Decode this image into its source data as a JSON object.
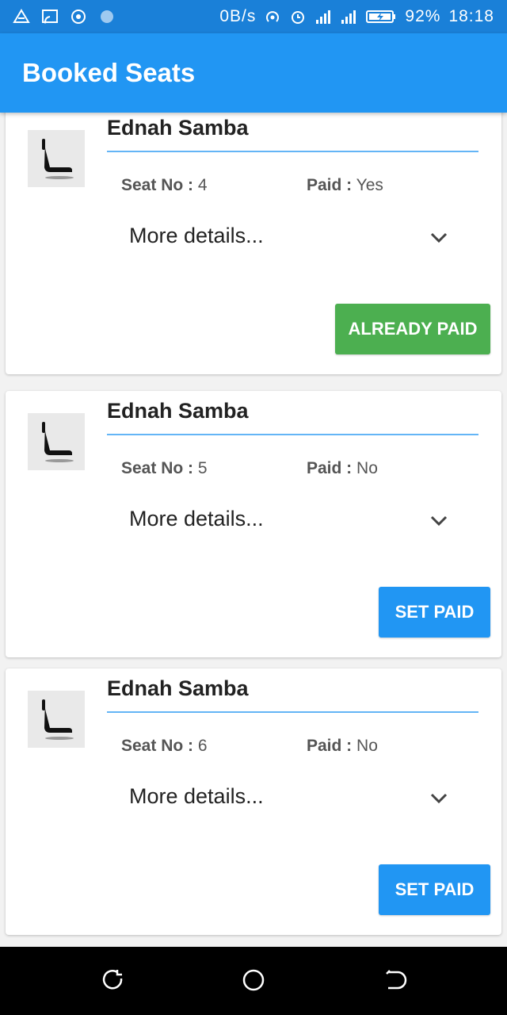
{
  "status_bar": {
    "left_icons": [
      "drive-icon",
      "cast-icon",
      "target-icon",
      "circle-dot-icon"
    ],
    "network_speed": "0B/s",
    "battery": "92%",
    "time": "18:18"
  },
  "app_bar": {
    "title": "Booked Seats"
  },
  "labels": {
    "seat_no": "Seat No :",
    "paid": "Paid :",
    "more_details": "More details..."
  },
  "bookings": [
    {
      "name": "Ednah Samba",
      "seat_no": "4",
      "paid": "Yes",
      "button_label": "ALREADY PAID",
      "button_color": "#4caf50"
    },
    {
      "name": "Ednah Samba",
      "seat_no": "5",
      "paid": "No",
      "button_label": "SET PAID",
      "button_color": "#2196f3"
    },
    {
      "name": "Ednah Samba",
      "seat_no": "6",
      "paid": "No",
      "button_label": "SET PAID",
      "button_color": "#2196f3"
    }
  ],
  "colors": {
    "status_bar": "#1a80d8",
    "app_bar": "#2196f3",
    "divider": "#64b5f6"
  },
  "nav_bar": {
    "icons": [
      "recent-apps-icon",
      "home-icon",
      "back-icon"
    ]
  }
}
